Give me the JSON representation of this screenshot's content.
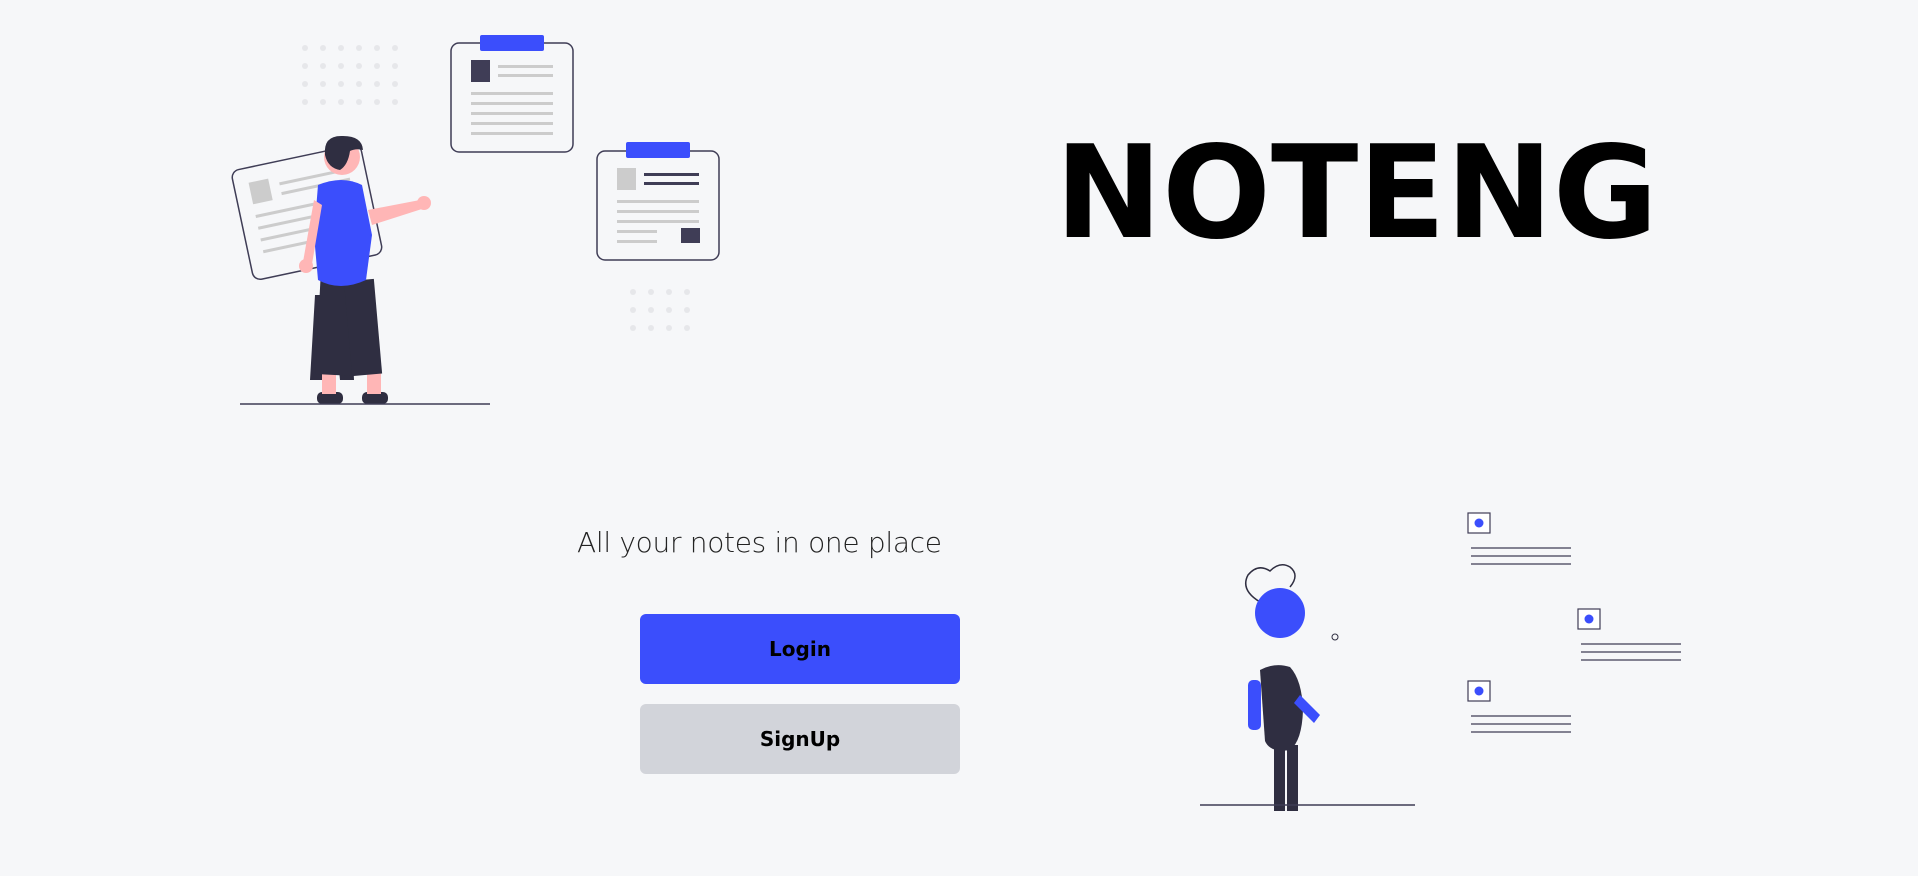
{
  "hero": {
    "title": "NOTENG",
    "tagline": "All your notes in one place"
  },
  "actions": {
    "login_label": "Login",
    "signup_label": "SignUp"
  },
  "colors": {
    "accent": "#3b4efc",
    "secondary_button": "#d2d4da",
    "background": "#f6f7f9",
    "dark": "#2f2e41",
    "skin": "#ffb6b6"
  },
  "illustrations": {
    "left": "person-reading-notes-illustration",
    "right": "person-viewing-note-cards-illustration"
  }
}
